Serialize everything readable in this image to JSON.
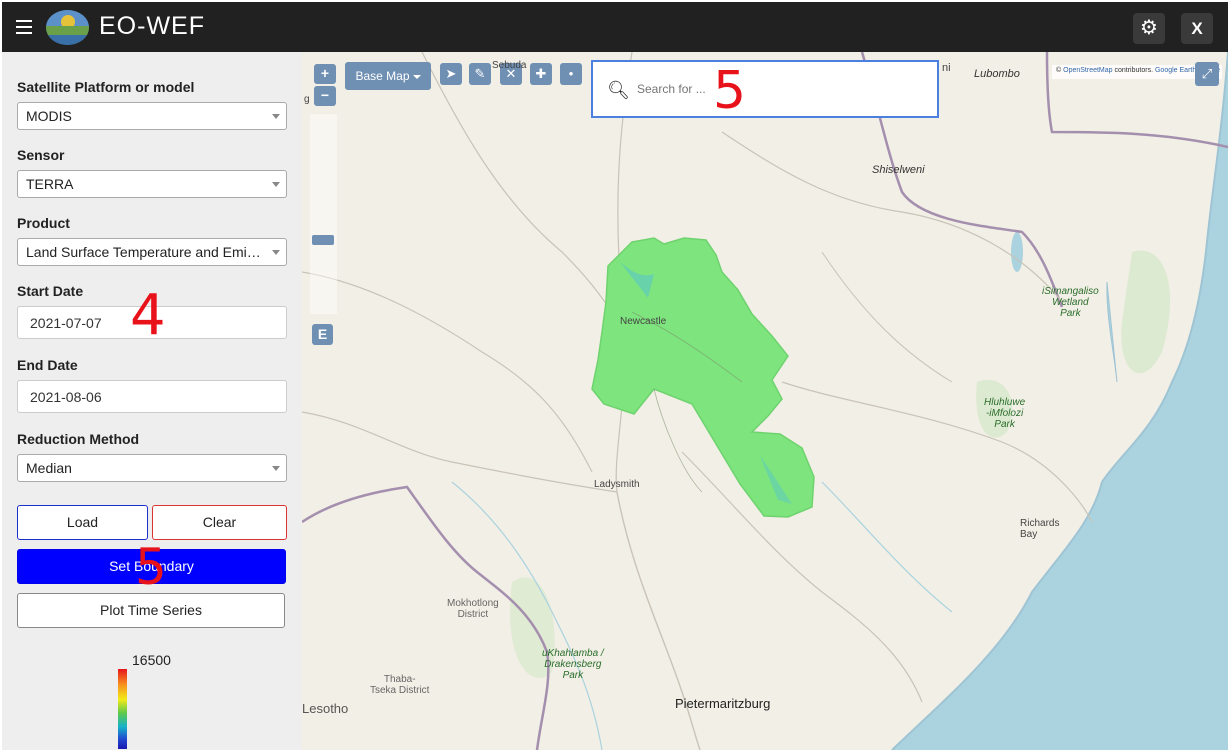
{
  "header": {
    "menu_icon": "hamburger-icon",
    "title": "EO-WEF",
    "settings_icon": "gear-icon",
    "close_label": "X"
  },
  "sidebar": {
    "platform_label": "Satellite Platform or model",
    "platform_value": "MODIS",
    "sensor_label": "Sensor",
    "sensor_value": "TERRA",
    "product_label": "Product",
    "product_value": "Land Surface Temperature and Emissivity",
    "start_label": "Start Date",
    "start_value": "2021-07-07",
    "end_label": "End Date",
    "end_value": "2021-08-06",
    "reduction_label": "Reduction Method",
    "reduction_value": "Median",
    "load_label": "Load",
    "clear_label": "Clear",
    "boundary_label": "Set Boundary",
    "plot_label": "Plot Time Series",
    "legend_max": "16500",
    "annotation_start": "4",
    "annotation_boundary": "5"
  },
  "map": {
    "zoom_in": "+",
    "zoom_out": "−",
    "e_label": "E",
    "basemap_label": "Base Map",
    "search_placeholder": "Search for ...",
    "search_annotation": "5",
    "attribution_prefix": "©",
    "attribution_osm": "OpenStreetMap",
    "attribution_mid": "contributors.",
    "attribution_google": "Google Earth Engine",
    "fullscreen_icon": "fullscreen-icon",
    "tools": [
      "select-arrow-icon",
      "pencil-icon",
      "delete-x-icon",
      "move-icon",
      "point-icon"
    ],
    "places": {
      "sebuda": "Sebuda",
      "lubombo": "Lubombo",
      "swazi_ni": "ni",
      "shiselweni": "Shiselweni",
      "isimangaliso": "iSimangaliso\nWetland\nPark",
      "newcastle": "Newcastle",
      "hluhluwe": "Hluhluwe\n-iMfolozi\nPark",
      "ladysmith": "Ladysmith",
      "richards_bay": "Richards\nBay",
      "mokhotlong": "Mokhotlong\nDistrict",
      "ukhahlamba": "uKhahlamba /\nDrakensberg\nPark",
      "thaba": "Thaba-\nTseka District",
      "lesotho": "Lesotho",
      "pietermaritzburg": "Pietermaritzburg",
      "left_g": "g"
    }
  },
  "colors": {
    "topbar": "#212121",
    "boundary_button": "#0000ff",
    "load_border": "#1a2fd0",
    "clear_border": "#dd3333",
    "annotation": "#e8121a",
    "search_border": "#4c80e0"
  }
}
